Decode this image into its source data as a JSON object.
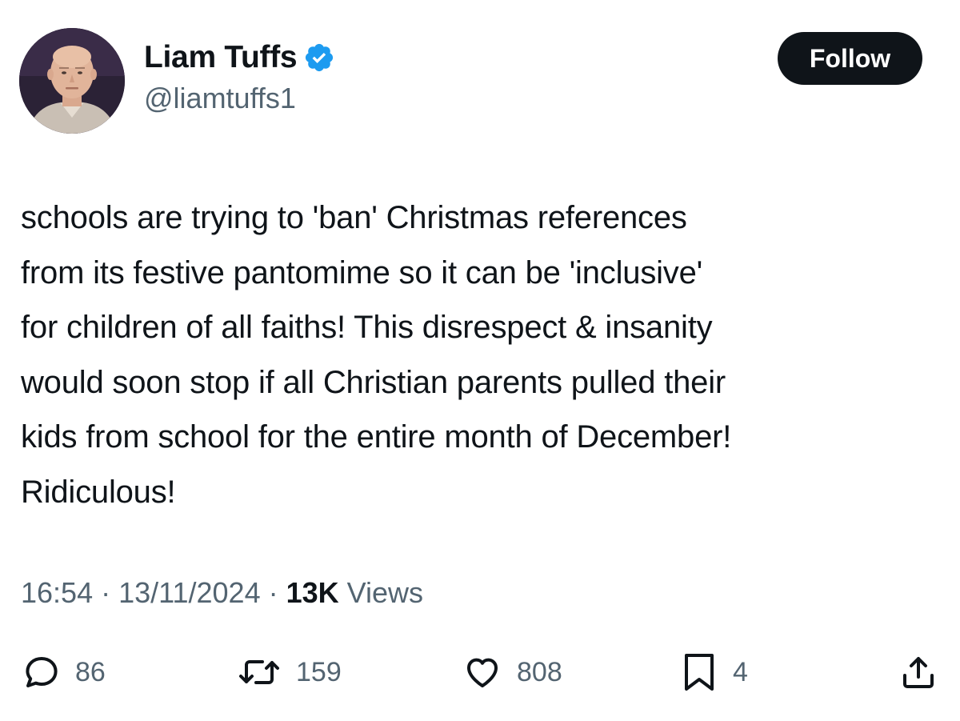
{
  "author": {
    "display_name": "Liam Tuffs",
    "handle": "@liamtuffs1",
    "verified": true,
    "avatar_icon": "profile-photo"
  },
  "follow_button": {
    "label": "Follow"
  },
  "tweet": {
    "text": "schools are trying to 'ban' Christmas references\nfrom its festive pantomime so it can be 'inclusive'\nfor children of all faiths! This disrespect & insanity\nwould soon stop if all Christian parents pulled their\nkids from school for the entire month of December!\nRidiculous!",
    "time": "16:54",
    "date": "13/11/2024",
    "separator": " · ",
    "views_count": "13K",
    "views_label": " Views"
  },
  "actions": {
    "reply": {
      "icon": "reply-icon",
      "count": "86"
    },
    "retweet": {
      "icon": "retweet-icon",
      "count": "159"
    },
    "like": {
      "icon": "heart-icon",
      "count": "808"
    },
    "bookmark": {
      "icon": "bookmark-icon",
      "count": "4"
    },
    "share": {
      "icon": "share-icon"
    }
  },
  "colors": {
    "text_primary": "#0f1419",
    "text_secondary": "#536471",
    "verified_blue": "#1d9bf0",
    "button_bg": "#0f1419",
    "button_text": "#ffffff"
  }
}
